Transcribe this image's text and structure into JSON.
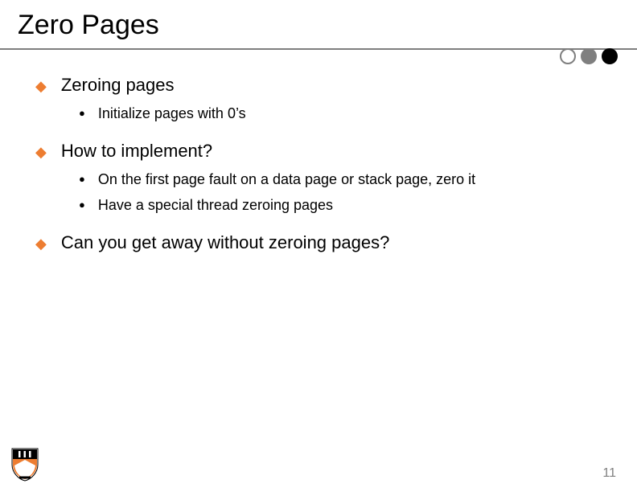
{
  "title": "Zero Pages",
  "page_number": "11",
  "bullets": {
    "b1": {
      "text": "Zeroing pages"
    },
    "b1_1": {
      "text": "Initialize pages with 0’s"
    },
    "b2": {
      "text": "How to implement?"
    },
    "b2_1": {
      "text": "On the first page fault on a data page or stack page, zero it"
    },
    "b2_2": {
      "text": "Have a special thread zeroing pages"
    },
    "b3": {
      "text": "Can you get away without zeroing pages?"
    }
  },
  "decor": {
    "circles": [
      "outline",
      "gray",
      "black"
    ]
  },
  "logo": {
    "name": "princeton-shield"
  }
}
